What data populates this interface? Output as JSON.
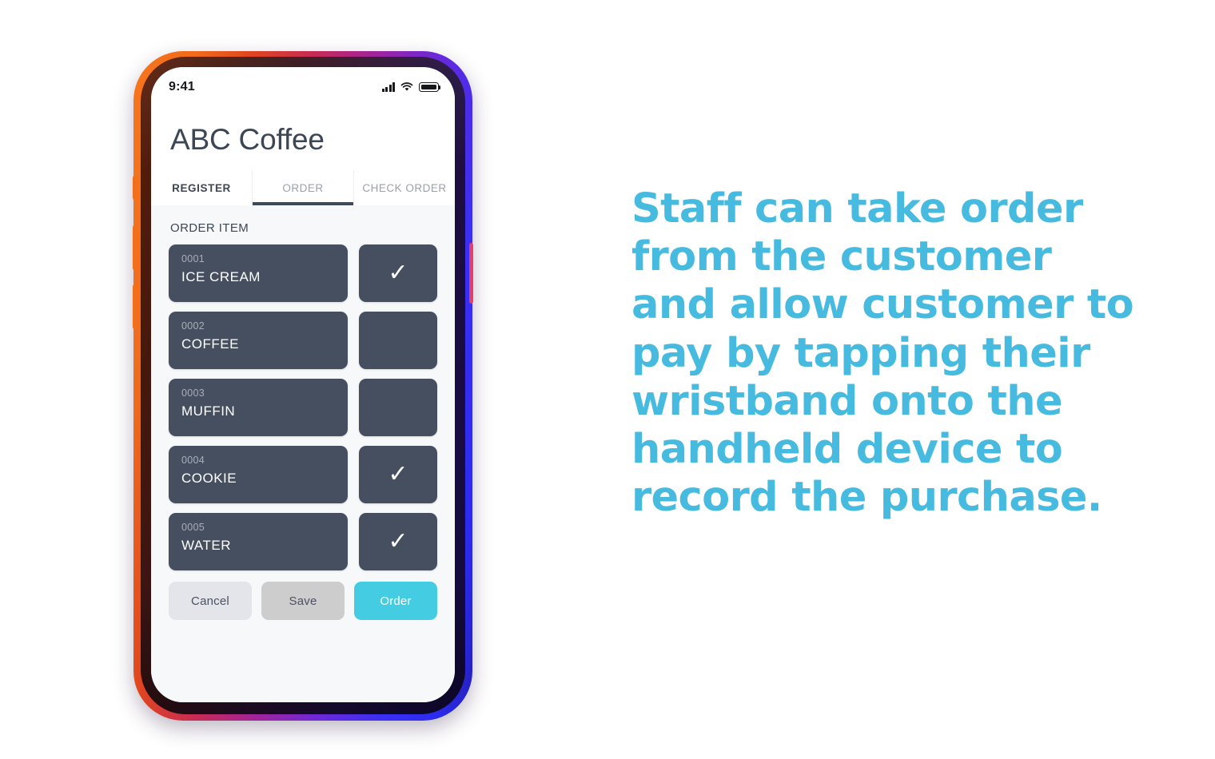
{
  "phone": {
    "status_bar": {
      "time": "9:41",
      "icons": [
        "signal-bars-icon",
        "wifi-icon",
        "battery-icon"
      ]
    },
    "app": {
      "title": "ABC Coffee",
      "tabs": [
        {
          "label": "REGISTER",
          "active": false
        },
        {
          "label": "ORDER",
          "active": true
        },
        {
          "label": "CHECK ORDER",
          "active": false
        }
      ],
      "section_label": "ORDER ITEM",
      "items": [
        {
          "code": "0001",
          "name": "ICE CREAM",
          "checked": true
        },
        {
          "code": "0002",
          "name": "COFFEE",
          "checked": false
        },
        {
          "code": "0003",
          "name": "MUFFIN",
          "checked": false
        },
        {
          "code": "0004",
          "name": "COOKIE",
          "checked": true
        },
        {
          "code": "0005",
          "name": "WATER",
          "checked": true
        }
      ],
      "buttons": {
        "cancel": "Cancel",
        "save": "Save",
        "order": "Order"
      }
    }
  },
  "caption": {
    "text": "Staff can take order from the customer and allow customer to pay by tapping their wristband onto the handheld device to record the purchase."
  },
  "colors": {
    "accent_cyan": "#44cde2",
    "caption_blue": "#47bbdf",
    "card_slate": "#464f60",
    "text_dark": "#3d4655",
    "tab_inactive": "#9aa1ac",
    "btn_cancel": "#e3e5ea",
    "btn_save": "#cdcdcd",
    "screen_bg": "#f7f8fa"
  }
}
